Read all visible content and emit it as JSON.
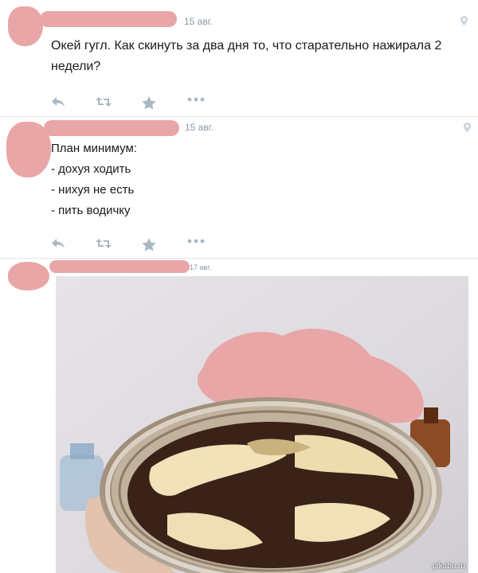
{
  "tweets": [
    {
      "date": "15 авг.",
      "text": "Окей гугл. Как скинуть за два дня то, что старательно нажирала 2\nнедели?"
    },
    {
      "date": "15 авг.",
      "text": "План минимум:\n- дохуя ходить\n- нихуя не есть\n- пить водичку"
    },
    {
      "date": "17 авг."
    }
  ],
  "icons": [
    "reply-icon",
    "retweet-icon",
    "favorite-star-icon",
    "more-dots-icon",
    "location-pin-icon"
  ],
  "colors": {
    "redaction_pink": "#e9a6a6",
    "icon_gray": "#8899a6",
    "separator": "#e1e8ed"
  },
  "watermark": "pikabu.ru"
}
